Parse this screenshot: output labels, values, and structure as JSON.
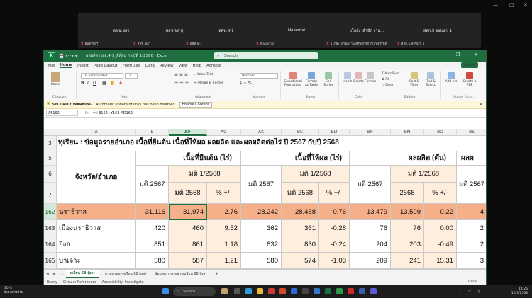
{
  "meeting": {
    "window_controls": [
      "—",
      "□",
      "✕"
    ],
    "tiles": [
      {
        "name": "ลชช.ชลฯ",
        "sub": "ผนท.ชลฯ"
      },
      {
        "name": "(สลข.ชลฯ)",
        "sub": "สลข.ชลฯ"
      },
      {
        "name": "สศท.8-1",
        "sub": "สศท.8-1"
      },
      {
        "name": "Nakornsi",
        "sub": "Nakornsi"
      },
      {
        "name": "ยโกล์ะ_สำนัก งาน...",
        "sub": "ยโกล์ะ_สำนักงานเศรษฐกิจการเกษตรเขต"
      },
      {
        "name": "สลก.5 ลงขนา_1",
        "sub": "สลก.5 ลงขนา_1"
      }
    ]
  },
  "excel": {
    "logo": "X",
    "quick_access": "💾 ↶ ↷ ▾",
    "doc_title": "ผลผลิตรายอ.4-5_อ้ท้อน กรณ์ที่ 1-2566 - Excel",
    "search_placeholder": "Search",
    "menu": [
      "File",
      "Home",
      "Insert",
      "Page Layout",
      "Formulas",
      "Data",
      "Review",
      "View",
      "Help",
      "Acrobat"
    ],
    "share": "Share",
    "ribbon": {
      "clipboard": "Clipboard",
      "paste": "Paste",
      "font_name": "TH SarabunPSK",
      "font_size": "12",
      "font": "Font",
      "wrap_text": "Wrap Text",
      "merge_center": "Merge & Center",
      "alignment": "Alignment",
      "number_format": "Number",
      "number": "Number",
      "cond_format": "Conditional Formatting",
      "format_table": "Format as Table",
      "cell_styles": "Cell Styles",
      "styles": "Styles",
      "insert": "Insert",
      "delete": "Delete",
      "format": "Format",
      "cells": "Cells",
      "autosum": "AutoSum",
      "fill": "Fill",
      "clear": "Clear",
      "sort_filter": "Sort & Filter",
      "find_select": "Find & Select",
      "editing": "Editing",
      "addins": "Add-ins",
      "create_pdf": "Create a PDF",
      "adobe": "Adobe Acro..."
    },
    "warning": {
      "label": "SECURITY WARNING",
      "text": "Automatic update of links has been disabled",
      "button": "Enable Content"
    },
    "name_box": "AF162",
    "fx": "fx",
    "formula": "=+E162+Y162-AD162",
    "columns": [
      "A",
      "E",
      "AF",
      "AG",
      "AK",
      "BC",
      "BD",
      "BH",
      "BN",
      "BO",
      "BS"
    ],
    "rows": {
      "r3": "3",
      "r5": "5",
      "r6": "6",
      "r7": "7",
      "r162": "162",
      "r163": "163",
      "r164": "164",
      "r165": "165"
    },
    "cells": {
      "title": "ทุเรียน : ข้อมูลรายอำเภอ เนื้อที่ยืนต้น เนื้อที่ให้ผล ผลผลิต และผลผลิตต่อไร่ ปี 2567 กับปี 2568",
      "province_district": "จังหวัด/อำเภอ",
      "standing_area": "เนื้อที่ยืนต้น (ไร่)",
      "harvested_area": "เนื้อที่ให้ผล (ไร่)",
      "production": "ผลผลิต (ตัน)",
      "yield_trunc": "ผลผ",
      "survey_2568": "มติ 1/2568",
      "survey_2567": "มติ 2567",
      "sub_2568": "มติ 2568",
      "sub_2568_short": "2568",
      "pct": "% +/-"
    },
    "data_rows": [
      {
        "name": "นราธิวาส",
        "E": "31,116",
        "AF": "31,974",
        "AG": "2.76",
        "AK": "28,242",
        "BC": "28,458",
        "BD": "0.76",
        "BH": "13,479",
        "BN": "13,509",
        "BO": "0.22",
        "BS": "4"
      },
      {
        "name": "เมืองนราธิวาส",
        "E": "420",
        "AF": "460",
        "AG": "9.52",
        "AK": "362",
        "BC": "361",
        "BD": "-0.28",
        "BH": "76",
        "BN": "76",
        "BO": "0.00",
        "BS": "2"
      },
      {
        "name": "ยี่งอ",
        "E": "851",
        "AF": "861",
        "AG": "1.18",
        "AK": "832",
        "BC": "830",
        "BD": "-0.24",
        "BH": "204",
        "BN": "203",
        "BO": "-0.49",
        "BS": "2"
      },
      {
        "name": "บาเจาะ",
        "E": "580",
        "AF": "587",
        "AG": "1.21",
        "AK": "580",
        "BC": "574",
        "BD": "-1.03",
        "BH": "209",
        "BN": "241",
        "BO": "15.31",
        "BS": "3"
      }
    ],
    "sheet_tabs": [
      "ทุเรียน 68 (ผล)",
      "การออกดอกทุเรียน 68 (ผล)",
      "ข้อมลเกาะครงจางทุเรียน 68 (ผล)"
    ],
    "status": {
      "ready": "Ready",
      "circular": "Circular References",
      "accessibility": "Accessibility: Investigate",
      "zoom": "100%"
    }
  },
  "taskbar": {
    "temp": "30°C",
    "weather": "มีเมฆบางส่วน",
    "search": "Search",
    "time": "14:26",
    "date": "10/3/2568"
  },
  "colors": {
    "excel_green": "#1e6e40",
    "highlight_row": "#f5b08a",
    "highlight_col": "#fdeede"
  }
}
